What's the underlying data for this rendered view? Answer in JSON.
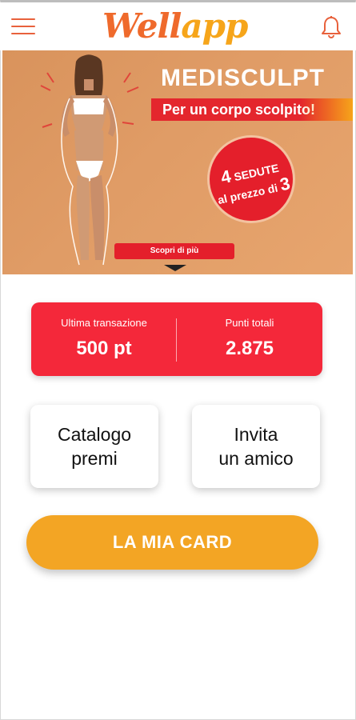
{
  "header": {
    "logo_word1": "Well",
    "logo_word2": "app",
    "menu_icon": "hamburger-menu-icon",
    "notifications_icon": "bell-icon"
  },
  "banner": {
    "title": "MEDISCULPT",
    "subtitle": "Per un corpo scolpito!",
    "promo_number": "4",
    "promo_text1": "SEDUTE",
    "promo_text2": "al prezzo di",
    "promo_number2": "3",
    "cta_label": "Scopri di più"
  },
  "points_card": {
    "last_transaction_label": "Ultima transazione",
    "last_transaction_value": "500 pt",
    "total_points_label": "Punti totali",
    "total_points_value": "2.875"
  },
  "tiles": [
    {
      "label": "Catalogo\npremi"
    },
    {
      "label": "Invita\nun amico"
    }
  ],
  "card_button": {
    "label": "LA MIA CARD"
  },
  "colors": {
    "accent_orange": "#f3a524",
    "logo_orange": "#ef6a2c",
    "points_red": "#f4283a",
    "banner_bg": "#e09c66"
  }
}
